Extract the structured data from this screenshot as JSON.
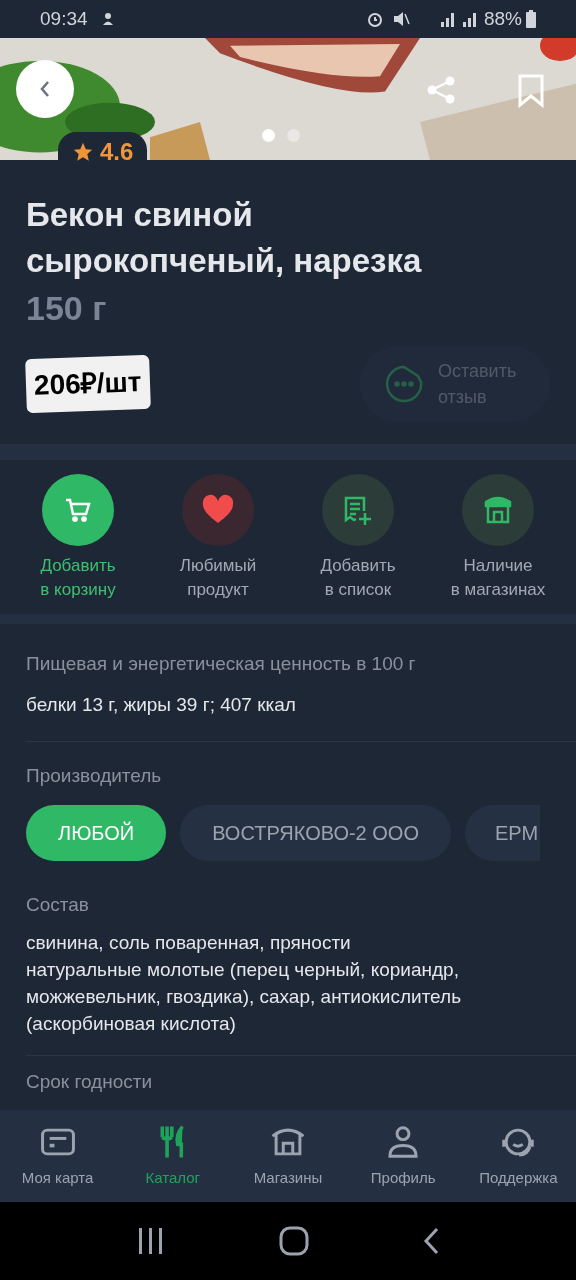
{
  "status_bar": {
    "time": "09:34",
    "battery": "88%"
  },
  "hero": {
    "kind": "picture",
    "slides": [
      {
        "selected": true
      },
      {
        "selected": false
      }
    ],
    "rating": "4.6"
  },
  "product": {
    "title": "Бекон свиной сырокопченый, нарезка",
    "weight": "150 г",
    "price": "206₽/шт",
    "review_button": {
      "label": "Оставить отзыв",
      "disabled": true
    }
  },
  "actions": [
    {
      "kind": "cart",
      "label": "Добавить в корзину",
      "active": true
    },
    {
      "kind": "heart",
      "label": "Любимый продукт",
      "active": false
    },
    {
      "kind": "list",
      "label": "Добавить в список",
      "active": false
    },
    {
      "kind": "store",
      "label": "Наличие в магазинах",
      "active": false
    }
  ],
  "nutrition": {
    "heading": "Пищевая и энергетическая ценность в 100 г",
    "text": "белки 13 г, жиры 39 г; 407 ккал"
  },
  "manufacturer": {
    "heading": "Производитель",
    "chips": [
      {
        "label": "ЛЮБОЙ",
        "selected": true
      },
      {
        "label": "ВОСТРЯКОВО-2 ООО",
        "selected": false
      },
      {
        "label": "ЕРМ",
        "selected": false
      }
    ]
  },
  "composition": {
    "heading": "Состав",
    "text": "свинина, соль поваренная, пряности натуральные молотые (перец черный, кориандр, можжевельник, гвоздика), сахар, антиокислитель (аскорбиновая кислота)"
  },
  "shelf_life": {
    "heading": "Срок годности"
  },
  "bottom_nav": [
    {
      "kind": "card",
      "label": "Моя карта",
      "selected": false
    },
    {
      "kind": "catalog",
      "label": "Каталог",
      "selected": true
    },
    {
      "kind": "store",
      "label": "Магазины",
      "selected": false
    },
    {
      "kind": "profile",
      "label": "Профиль",
      "selected": false
    },
    {
      "kind": "support",
      "label": "Поддержка",
      "selected": false
    }
  ]
}
